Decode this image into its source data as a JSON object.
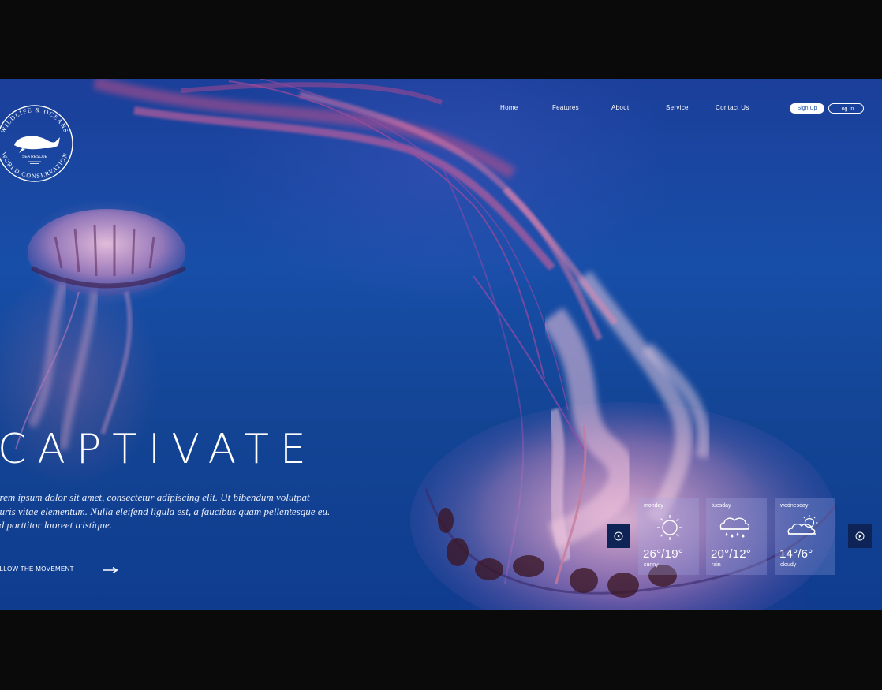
{
  "logo": {
    "ring_top_text": "WILDLIFE & OCEANS",
    "ring_bottom_text": "WORLD CONSERVATION",
    "badge_text": "SEA RESCUE"
  },
  "nav": {
    "items": [
      {
        "label": "Home"
      },
      {
        "label": "Features"
      },
      {
        "label": "About"
      },
      {
        "label": "Service"
      },
      {
        "label": "Contact Us"
      }
    ]
  },
  "auth": {
    "signup_label": "Sign Up",
    "login_label": "Log In"
  },
  "hero": {
    "title": "CAPTIVATE",
    "body_line1": "orem ipsum dolor sit amet, consectetur adipiscing elit. Ut bibendum volutpat",
    "body_line2": "auris vitae elementum. Nulla eleifend ligula est, a faucibus quam pellentesque eu.",
    "body_line3": "ed porttitor laoreet tristique.",
    "cta_label": "OLLOW THE MOVEMENT"
  },
  "weather": {
    "days": [
      {
        "day": "monday",
        "temp": "26°/19°",
        "condition": "sunny",
        "icon": "sun-icon"
      },
      {
        "day": "tuesday",
        "temp": "20°/12°",
        "condition": "rain",
        "icon": "rain-cloud-icon"
      },
      {
        "day": "wednesday",
        "temp": "14°/6°",
        "condition": "cloudy",
        "icon": "cloud-sun-icon"
      }
    ]
  },
  "colors": {
    "background_deep": "#0f3c8f",
    "background_mid": "#174ea8",
    "arrow_button": "#0f2456",
    "text": "#ffffff"
  }
}
